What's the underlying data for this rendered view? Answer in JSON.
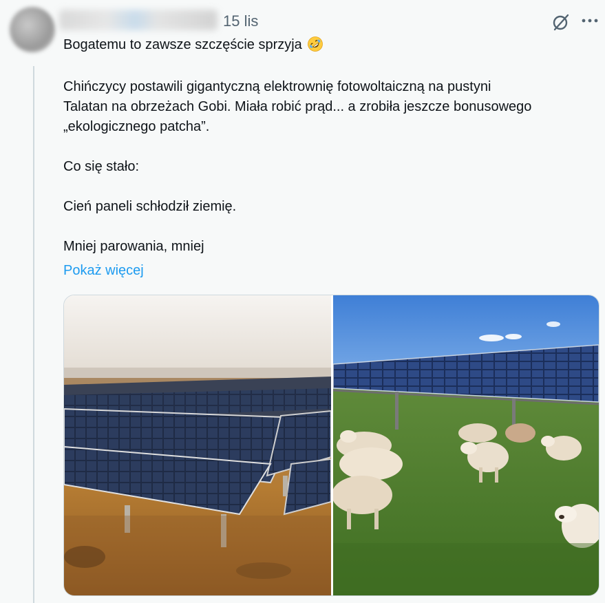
{
  "tweet": {
    "timestamp": "15 lis",
    "headline": "Bogatemu to zawsze szczęście sprzyja",
    "headline_emoji": "rolling-on-floor-laughing-emoji",
    "body": "Chińczycy postawili gigantyczną elektrownię fotowoltaiczną na pustyni\nTalatan na obrzeżach Gobi. Miała robić prąd... a zrobiła jeszcze bonusowego\n„ekologicznego patcha”.\n\nCo się stało:\n\nCień paneli schłodził ziemię.\n\nMniej parowania, mniej",
    "show_more": "Pokaż więcej"
  },
  "media": {
    "images": [
      {
        "name": "solar-panels-desert-photo"
      },
      {
        "name": "sheep-under-solar-panels-photo"
      }
    ]
  },
  "icons": {
    "grok": "grok-icon",
    "more": "more-options-icon"
  },
  "colors": {
    "link": "#1d9bf0",
    "text": "#0f1419",
    "muted": "#536471",
    "background": "#f7f9f9"
  }
}
